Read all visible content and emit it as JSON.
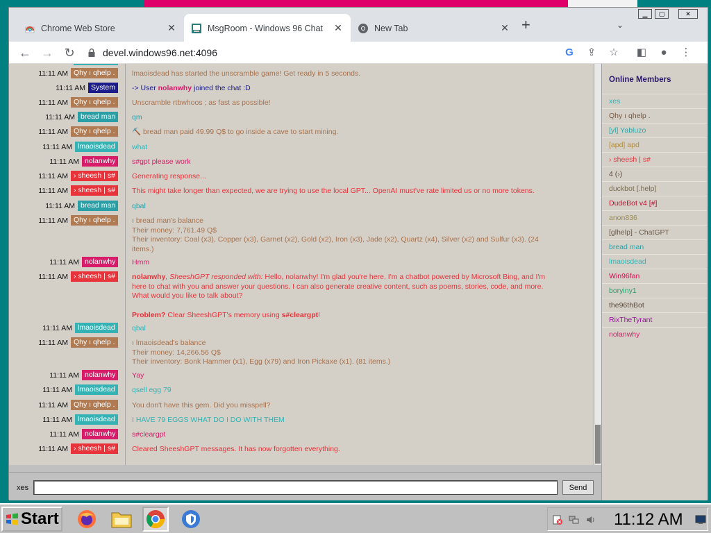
{
  "browser": {
    "tabs": [
      {
        "label": "Chrome Web Store",
        "icon": "chrome-web-store-icon",
        "active": false
      },
      {
        "label": "MsgRoom - Windows 96 Chat",
        "icon": "msgroom-icon",
        "active": true
      },
      {
        "label": "New Tab",
        "icon": "chrome-icon",
        "active": false
      }
    ],
    "url": "devel.windows96.net:4096"
  },
  "colors": {
    "qhy": "#b07a52",
    "system": "#1c1c8a",
    "bread": "#2a9fa6",
    "lmao": "#34b2b4",
    "nolan": "#d91c6a",
    "sheesh": "#e8333a",
    "accent_msg_qhy": "#b0704a",
    "system_msg": "#1c1c8a"
  },
  "chat": {
    "messages": [
      {
        "time": "11:11 AM",
        "user": "Qhy ı qhelp .",
        "color": "qhy",
        "text": "lmaoisdead has started the unscramble game! Get ready in 5 seconds."
      },
      {
        "time": "11:11 AM",
        "user": "System",
        "color": "system",
        "text": "-> User nolanwhy joined the chat :D"
      },
      {
        "time": "11:11 AM",
        "user": "Qhy ı qhelp .",
        "color": "qhy",
        "text": "Unscramble rtbwhoos ; as fast as possible!"
      },
      {
        "time": "11:11 AM",
        "user": "bread man",
        "color": "bread",
        "text": "qm"
      },
      {
        "time": "11:11 AM",
        "user": "Qhy ı qhelp .",
        "color": "qhy",
        "text": "⛏️ bread man paid 49.99 Q$ to go inside a cave to start mining."
      },
      {
        "time": "11:11 AM",
        "user": "lmaoisdead",
        "color": "lmao",
        "text": "what"
      },
      {
        "time": "11:11 AM",
        "user": "nolanwhy",
        "color": "nolan",
        "text": "s#gpt please work"
      },
      {
        "time": "11:11 AM",
        "user": "› sheesh | s#",
        "color": "sheesh",
        "text": "Generating response..."
      },
      {
        "time": "11:11 AM",
        "user": "› sheesh | s#",
        "color": "sheesh",
        "text": "This might take longer than expected, we are trying to use the local GPT... OpenAI must've rate limited us or no more tokens."
      },
      {
        "time": "11:11 AM",
        "user": "bread man",
        "color": "bread",
        "text": "qbal"
      },
      {
        "time": "11:11 AM",
        "user": "Qhy ı qhelp .",
        "color": "qhy",
        "lines": [
          "ı bread man's balance",
          "Their money: 7,761.49 Q$",
          "Their inventory: Coal (x3), Copper (x3), Garnet (x2), Gold (x2), Iron (x3), Jade (x2), Quartz (x4), Silver (x2) and Sulfur (x3). (24",
          "items.)"
        ]
      },
      {
        "time": "11:11 AM",
        "user": "nolanwhy",
        "color": "nolan",
        "text": "Hmm"
      },
      {
        "time": "11:11 AM",
        "user": "› sheesh | s#",
        "color": "sheesh",
        "gpt": {
          "name": "nolanwhy",
          "prefix": ", SheeshGPT responded with:",
          "lines": [
            " Hello, nolanwhy! I'm glad you're here. I'm a chatbot powered by Microsoft Bing, and I'm",
            "here to chat with you and answer your questions. I can also generate creative content, such as poems, stories, code, and more.",
            "What would you like to talk about?"
          ],
          "problem": "Problem?",
          "clear_text": " Clear SheeshGPT's memory using ",
          "cmd": "s#cleargpt",
          "bang": "!"
        }
      },
      {
        "time": "11:11 AM",
        "user": "lmaoisdead",
        "color": "lmao",
        "text": "qbal"
      },
      {
        "time": "11:11 AM",
        "user": "Qhy ı qhelp .",
        "color": "qhy",
        "lines": [
          "ı lmaoisdead's balance",
          "Their money: 14,266.56 Q$",
          "Their inventory: Bonk Hammer (x1), Egg (x79) and Iron Pickaxe (x1). (81 items.)"
        ]
      },
      {
        "time": "11:11 AM",
        "user": "nolanwhy",
        "color": "nolan",
        "text": "Yay"
      },
      {
        "time": "11:11 AM",
        "user": "lmaoisdead",
        "color": "lmao",
        "text": "qsell egg 79"
      },
      {
        "time": "11:11 AM",
        "user": "Qhy ı qhelp .",
        "color": "qhy",
        "text": "You don't have this gem. Did you misspell?"
      },
      {
        "time": "11:11 AM",
        "user": "lmaoisdead",
        "color": "lmao",
        "text": "I HAVE 79 EGGS WHAT DO I DO WITH THEM"
      },
      {
        "time": "11:11 AM",
        "user": "nolanwhy",
        "color": "nolan",
        "text": "s#cleargpt"
      },
      {
        "time": "11:11 AM",
        "user": "› sheesh | s#",
        "color": "sheesh",
        "text": "Cleared SheeshGPT messages. It has now forgotten everything."
      }
    ]
  },
  "members": {
    "title": "Online Members",
    "items": [
      {
        "name": "xes",
        "color": "#34b2b4"
      },
      {
        "name": "Qhy ı qhelp .",
        "color": "#7a5a40"
      },
      {
        "name": "[yl] Yabluzo",
        "color": "#2aa7a7"
      },
      {
        "name": "[apd] apd",
        "color": "#b08a3a"
      },
      {
        "name": "› sheesh | s#",
        "color": "#e8333a"
      },
      {
        "name": "4 (›)",
        "color": "#5a4a3a"
      },
      {
        "name": "duckbot [.help]",
        "color": "#7a6a4a"
      },
      {
        "name": "DudeBot v4 [#]",
        "color": "#c01030"
      },
      {
        "name": "anon836",
        "color": "#9a8a4a"
      },
      {
        "name": "[glhelp] - ChatGPT",
        "color": "#6a5a4a"
      },
      {
        "name": "bread man",
        "color": "#2a9fa6"
      },
      {
        "name": "lmaoisdead",
        "color": "#34b2b4"
      },
      {
        "name": "Win96fan",
        "color": "#d01050"
      },
      {
        "name": "boryiny1",
        "color": "#2a9a6a"
      },
      {
        "name": "the96thBot",
        "color": "#5a4a3a"
      },
      {
        "name": "RixTheTyrant",
        "color": "#9a10a0"
      },
      {
        "name": "nolanwhy",
        "color": "#d91c6a"
      }
    ]
  },
  "input": {
    "nick": "xes",
    "value": "",
    "placeholder": "",
    "send_label": "Send"
  },
  "taskbar": {
    "start_label": "Start",
    "clock": "11:12 AM"
  }
}
